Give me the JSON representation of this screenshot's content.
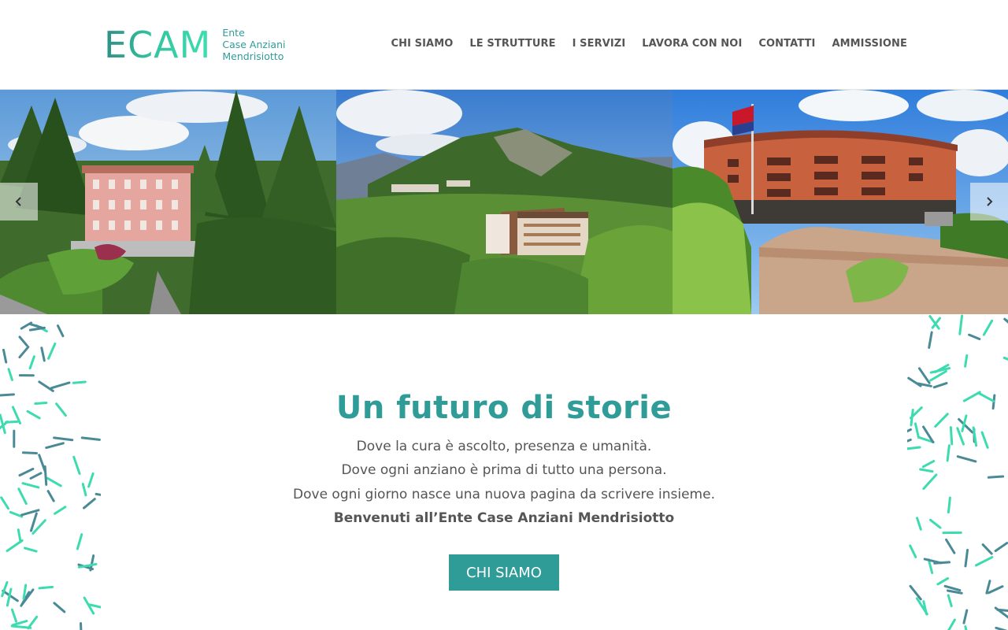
{
  "header": {
    "logo": {
      "mark": "ECAM",
      "sub": [
        "Ente",
        "Case Anziani",
        "Mendrisiotto"
      ]
    },
    "nav": [
      "CHI SIAMO",
      "LE STRUTTURE",
      "I SERVIZI",
      "LAVORA CON NOI",
      "CONTATTI",
      "AMMISSIONE"
    ]
  },
  "slider": {
    "slides": [
      {
        "icon": "pink-villa-park-photo"
      },
      {
        "icon": "mountain-valley-building-photo"
      },
      {
        "icon": "round-brick-building-flag-photo"
      }
    ],
    "prev_icon": "chevron-left-icon",
    "next_icon": "chevron-right-icon"
  },
  "hero": {
    "title": "Un futuro di storie",
    "lines": [
      "Dove la cura è ascolto, presenza e umanità.",
      "Dove ogni anziano è prima di tutto una persona.",
      "Dove ogni giorno nasce una nuova pagina da scrivere insieme."
    ],
    "welcome": "Benvenuti all’Ente Case Anziani Mendrisiotto",
    "cta_label": "CHI SIAMO"
  },
  "colors": {
    "accent": "#2f9c98",
    "accent_light": "#3ce0b0",
    "text": "#555555",
    "pattern_teal": "#3ddbb0",
    "pattern_dark": "#4a8a96"
  }
}
